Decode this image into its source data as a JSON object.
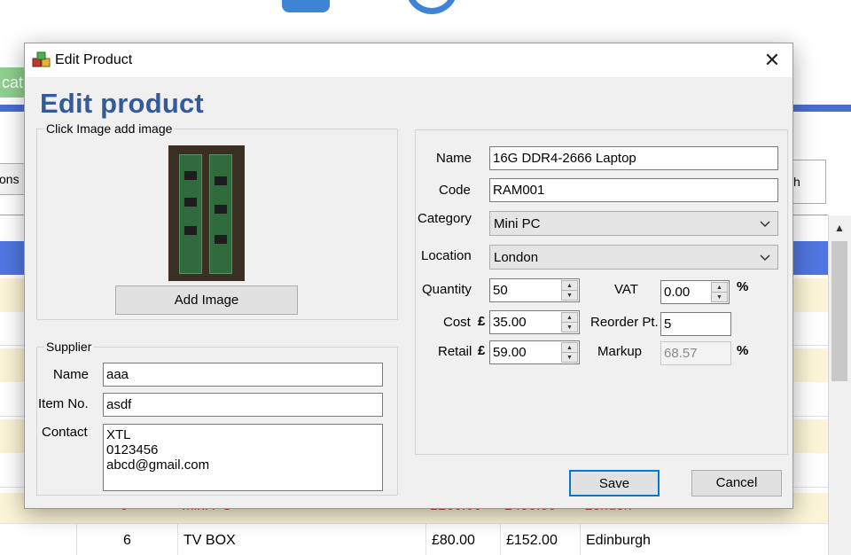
{
  "background": {
    "tab_label": "cati",
    "left_button_label": "ons",
    "right_button_label": "h",
    "partial_row": {
      "col1": "0",
      "col2": "Mini PC",
      "col3": "£260.00",
      "col4": "£490.00",
      "col5": "London"
    },
    "last_row": {
      "id": "6",
      "name": "TV BOX",
      "cost": "£80.00",
      "retail": "£152.00",
      "location": "Edinburgh"
    }
  },
  "dialog": {
    "title": "Edit Product",
    "heading": "Edit product",
    "image_group": {
      "legend": "Click Image add image",
      "add_image_label": "Add Image"
    },
    "supplier": {
      "legend": "Supplier",
      "name_label": "Name",
      "name_value": "aaa",
      "item_no_label": "Item No.",
      "item_no_value": "asdf",
      "contact_label": "Contact",
      "contact_lines": [
        "XTL",
        "0123456",
        "abcd@gmail.com"
      ]
    },
    "details": {
      "name_label": "Name",
      "name_value": "16G DDR4-2666 Laptop",
      "code_label": "Code",
      "code_value": "RAM001",
      "category_label": "Category",
      "category_value": "Mini PC",
      "location_label": "Location",
      "location_value": "London",
      "quantity_label": "Quantity",
      "quantity_value": "50",
      "vat_label": "VAT",
      "vat_value": "0.00",
      "vat_unit": "%",
      "cost_label": "Cost",
      "currency_symbol": "£",
      "cost_value": "35.00",
      "reorder_label": "Reorder Pt.",
      "reorder_value": "5",
      "retail_label": "Retail",
      "retail_value": "59.00",
      "markup_label": "Markup",
      "markup_value": "68.57",
      "markup_unit": "%"
    },
    "save_label": "Save",
    "cancel_label": "Cancel",
    "close_glyph": "✕"
  },
  "colors": {
    "heading": "#355a9a",
    "selected_row": "#4f76e0",
    "alt_row": "#fbf4d6",
    "accent_focus": "#0078d7"
  },
  "icons": [
    "app-cubes-icon",
    "close-icon",
    "chevron-down-icon",
    "spin-up-icon",
    "spin-down-icon"
  ]
}
